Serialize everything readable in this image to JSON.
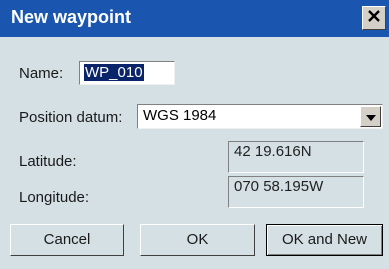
{
  "dialog": {
    "title": "New waypoint",
    "close_glyph": "X",
    "name_label": "Name:",
    "name_value": "WP_010",
    "datum_label": "Position datum:",
    "datum_value": "WGS 1984",
    "latitude_label": "Latitude:",
    "latitude_value": "42 19.616N",
    "longitude_label": "Longitude:",
    "longitude_value": "070 58.195W"
  },
  "buttons": {
    "cancel": "Cancel",
    "ok": "OK",
    "ok_and_new": "OK and New"
  },
  "icons": {
    "close": "close-icon",
    "dropdown": "chevron-down-icon"
  },
  "colors": {
    "titlebar": "#1a55b0",
    "dialog_bg": "#d4e0e4",
    "selection": "#0a246a"
  }
}
